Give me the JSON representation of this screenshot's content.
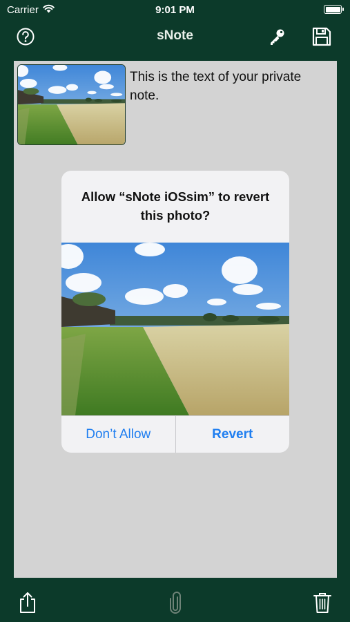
{
  "status_bar": {
    "carrier": "Carrier",
    "time": "9:01 PM",
    "battery_percent": 100
  },
  "nav_bar": {
    "title": "sNote",
    "left_icon": "help-icon",
    "right_icons": [
      "key-icon",
      "save-icon"
    ]
  },
  "note": {
    "text": "This is the text of your private note.",
    "attachment_icon": "photo-thumbnail"
  },
  "alert": {
    "title": "Allow “sNote iOSsim” to revert this photo?",
    "deny_label": "Don’t Allow",
    "confirm_label": "Revert"
  },
  "toolbar": {
    "icons": [
      "share-icon",
      "paperclip-icon",
      "trash-icon"
    ]
  },
  "colors": {
    "background": "#0c3a2a",
    "note_area": "#d3d3d3",
    "alert_button": "#1f7ef0"
  }
}
